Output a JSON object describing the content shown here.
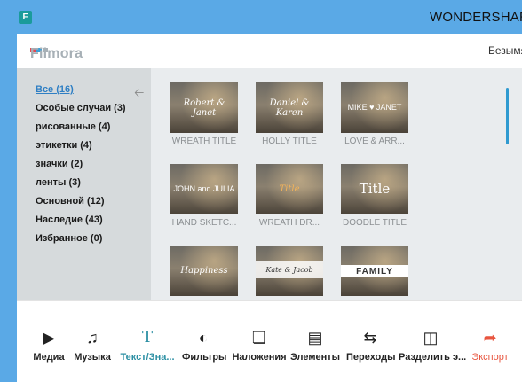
{
  "window": {
    "title": "WONDERSHARE",
    "app_icon_letter": "F"
  },
  "header": {
    "logo_text": "Filmora",
    "project_name": "Безымянный"
  },
  "sidebar": {
    "categories": [
      {
        "label": "Все (16)",
        "active": true
      },
      {
        "label": "Особые случаи (3)"
      },
      {
        "label": "рисованные (4)"
      },
      {
        "label": "этикетки (4)"
      },
      {
        "label": "значки (2)"
      },
      {
        "label": "ленты (3)"
      },
      {
        "label": "Основной (12)"
      },
      {
        "label": "Наследие (43)"
      },
      {
        "label": "Избранное (0)"
      }
    ]
  },
  "titles": [
    {
      "label": "WREATH TITLE",
      "preview": "Robert & Janet"
    },
    {
      "label": "HOLLY TITLE",
      "preview": "Daniel & Karen"
    },
    {
      "label": "LOVE & ARR...",
      "preview": "MIKE ♥ JANET"
    },
    {
      "label": "HAND SKETC...",
      "preview": "JOHN and JULIA"
    },
    {
      "label": "WREATH DR...",
      "preview": "Title"
    },
    {
      "label": "DOODLE TITLE",
      "preview": "Title"
    },
    {
      "label": "",
      "preview": "Happiness"
    },
    {
      "label": "",
      "preview": "Kate & Jacob"
    },
    {
      "label": "",
      "preview": "FAMILY"
    }
  ],
  "toolbar": {
    "media": "Медиа",
    "music": "Музыка",
    "text": "Текст/Зна...",
    "filters": "Фильтры",
    "overlays": "Наложения",
    "elements": "Элементы",
    "transitions": "Переходы",
    "split": "Разделить э...",
    "export": "Экспорт"
  },
  "colors": {
    "accent": "#2f7fc4",
    "export": "#e8553f",
    "active_tool": "#2b8fa3"
  }
}
